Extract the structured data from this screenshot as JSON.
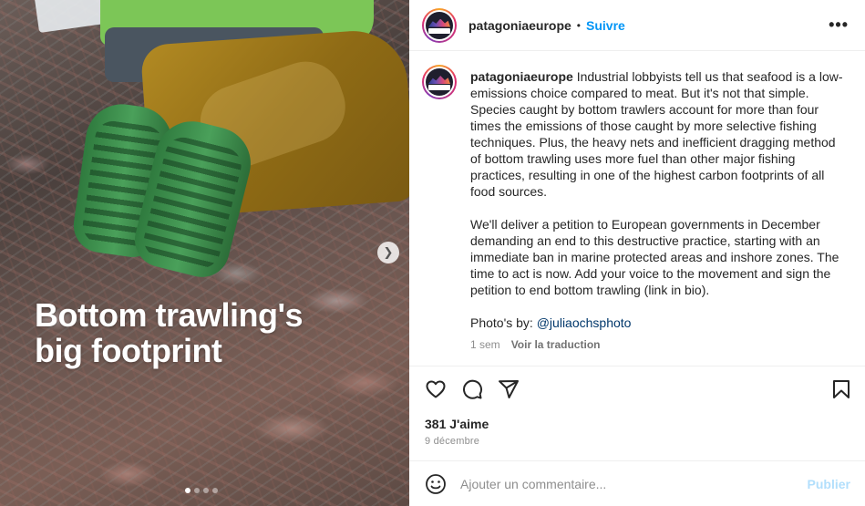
{
  "post": {
    "headline": "Bottom trawling's big footprint",
    "carousel": {
      "index": 1,
      "count": 4
    }
  },
  "header": {
    "username": "patagoniaeurope",
    "separator": "•",
    "follow_label": "Suivre",
    "more_label": "•••"
  },
  "caption": {
    "username": "patagoniaeurope",
    "paragraph1": "Industrial lobbyists tell us that seafood is a low-emissions choice compared to meat. But it's not that simple. Species caught by bottom trawlers account for more than four times the emissions of those caught by more selective fishing techniques. Plus, the heavy nets and inefficient dragging method of bottom trawling uses more fuel than other major fishing practices, resulting in one of the highest carbon footprints of all food sources.",
    "paragraph2": "We'll deliver a petition to European governments in December demanding an end to this destructive practice, starting with an immediate ban in marine protected areas and inshore zones. The time to act is now. Add your voice to the movement and sign the petition to end bottom trawling (link in bio).",
    "photo_credit_label": "Photo's by:",
    "photo_credit_handle": "@juliaochsphoto",
    "age": "1 sem",
    "translate_label": "Voir la traduction"
  },
  "engagement": {
    "likes": "381 J'aime",
    "date": "9 décembre"
  },
  "comment": {
    "placeholder": "Ajouter un commentaire...",
    "publish_label": "Publier"
  },
  "colors": {
    "accent": "#0095f6",
    "publish_disabled": "#b2dffc",
    "mention": "#00376b"
  },
  "icons": [
    "next-arrow-icon",
    "more-options-icon",
    "heart-icon",
    "comment-icon",
    "share-icon",
    "bookmark-icon",
    "emoji-icon"
  ]
}
